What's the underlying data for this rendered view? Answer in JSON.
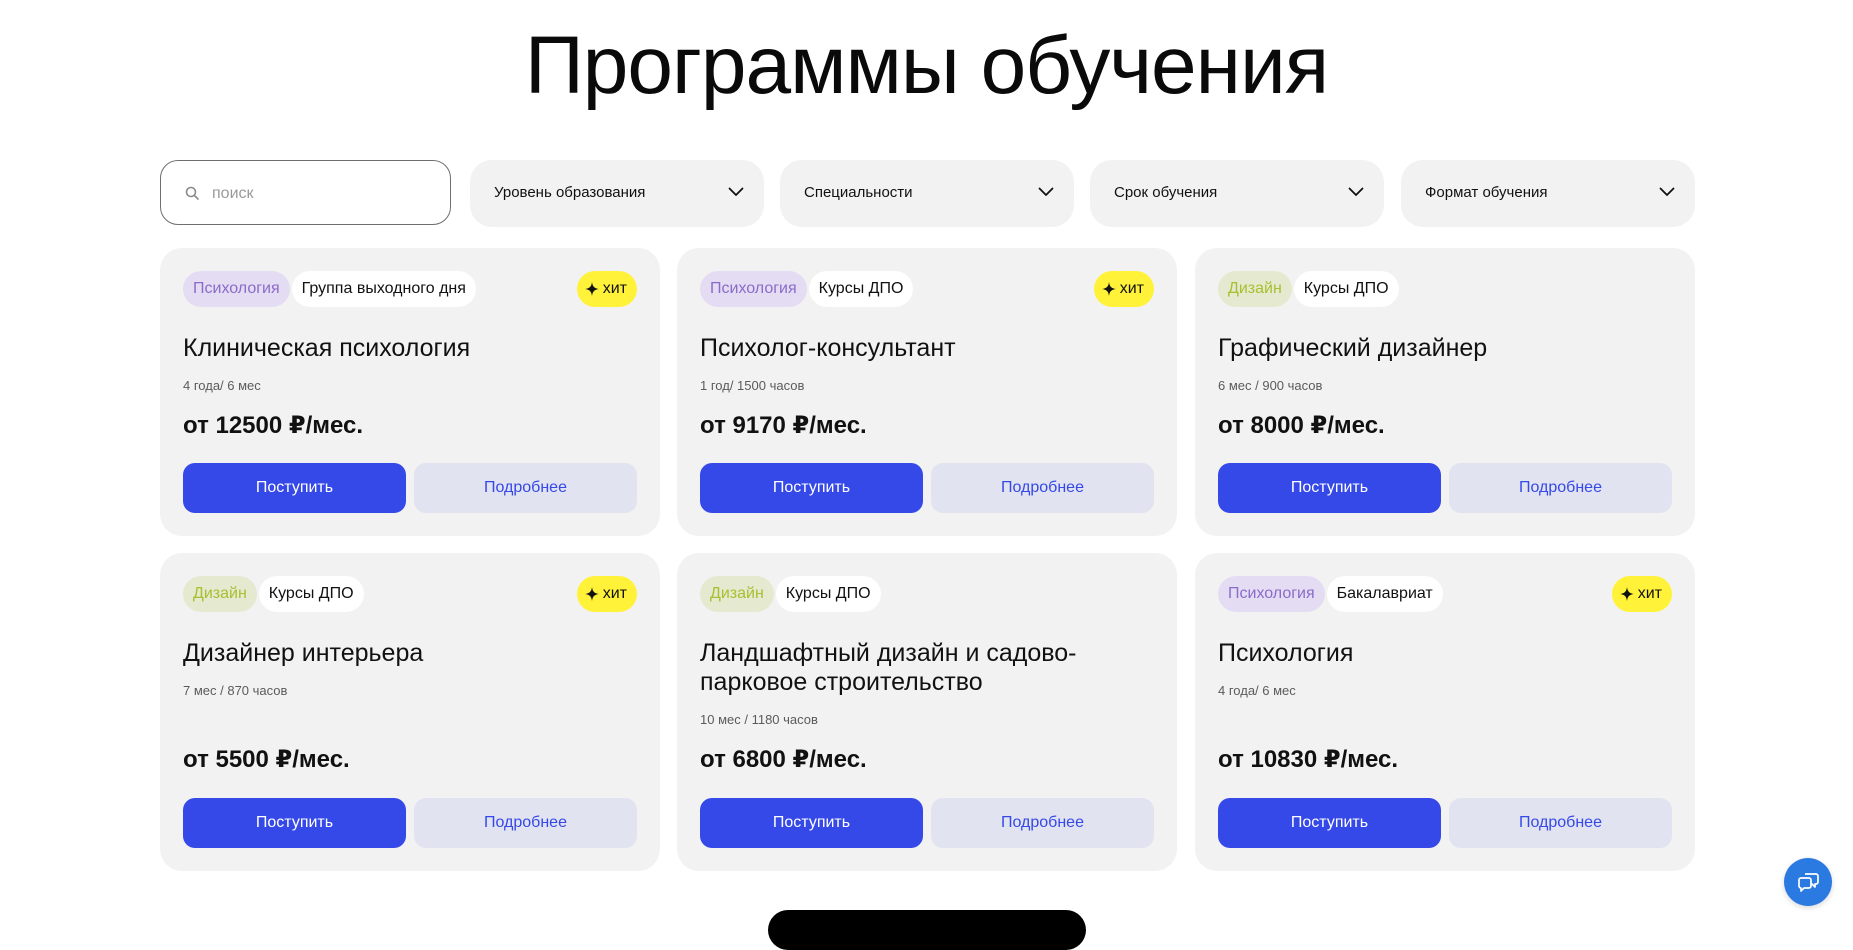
{
  "page": {
    "title": "Программы обучения"
  },
  "filters": {
    "search_placeholder": "поиск",
    "dropdowns": [
      {
        "label": "Уровень образования"
      },
      {
        "label": "Специальности"
      },
      {
        "label": "Срок обучения"
      },
      {
        "label": "Формат обучения"
      }
    ]
  },
  "colors": {
    "primary": "#3548e8",
    "card_bg": "#f2f2f2",
    "hit_badge": "#fff239",
    "psychology_tag": "#8a6bc9",
    "design_tag": "#a8bf2f"
  },
  "cards": [
    {
      "category": "Психология",
      "type": "Группа выходного дня",
      "hit": "хит",
      "title": "Клиническая психология",
      "duration": "4 года/ 6 мес",
      "price": "от 12500 ₽/мес.",
      "apply_label": "Поступить",
      "details_label": "Подробнее"
    },
    {
      "category": "Психология",
      "type": "Курсы ДПО",
      "hit": "хит",
      "title": "Психолог-консультант",
      "duration": "1 год/ 1500 часов",
      "price": "от 9170 ₽/мес.",
      "apply_label": "Поступить",
      "details_label": "Подробнее"
    },
    {
      "category": "Дизайн",
      "type": "Курсы ДПО",
      "hit": "",
      "title": "Графический дизайнер",
      "duration": "6 мес / 900 часов",
      "price": "от 8000 ₽/мес.",
      "apply_label": "Поступить",
      "details_label": "Подробнее"
    },
    {
      "category": "Дизайн",
      "type": "Курсы ДПО",
      "hit": "хит",
      "title": "Дизайнер интерьера",
      "duration": "7 мес / 870 часов",
      "price": "от 5500 ₽/мес.",
      "apply_label": "Поступить",
      "details_label": "Подробнее"
    },
    {
      "category": "Дизайн",
      "type": "Курсы ДПО",
      "hit": "",
      "title": "Ландшафтный дизайн и садово-парковое строительство",
      "duration": "10 мес / 1180 часов",
      "price": "от 6800 ₽/мес.",
      "apply_label": "Поступить",
      "details_label": "Подробнее"
    },
    {
      "category": "Психология",
      "type": "Бакалавриат",
      "hit": "хит",
      "title": "Психология",
      "duration": "4 года/ 6 мес",
      "price": "от 10830 ₽/мес.",
      "apply_label": "Поступить",
      "details_label": "Подробнее"
    }
  ],
  "icons": {
    "search": "search-icon",
    "chevron": "chevron-down-icon",
    "sparkle": "sparkle-icon",
    "chat": "chat-icon"
  }
}
